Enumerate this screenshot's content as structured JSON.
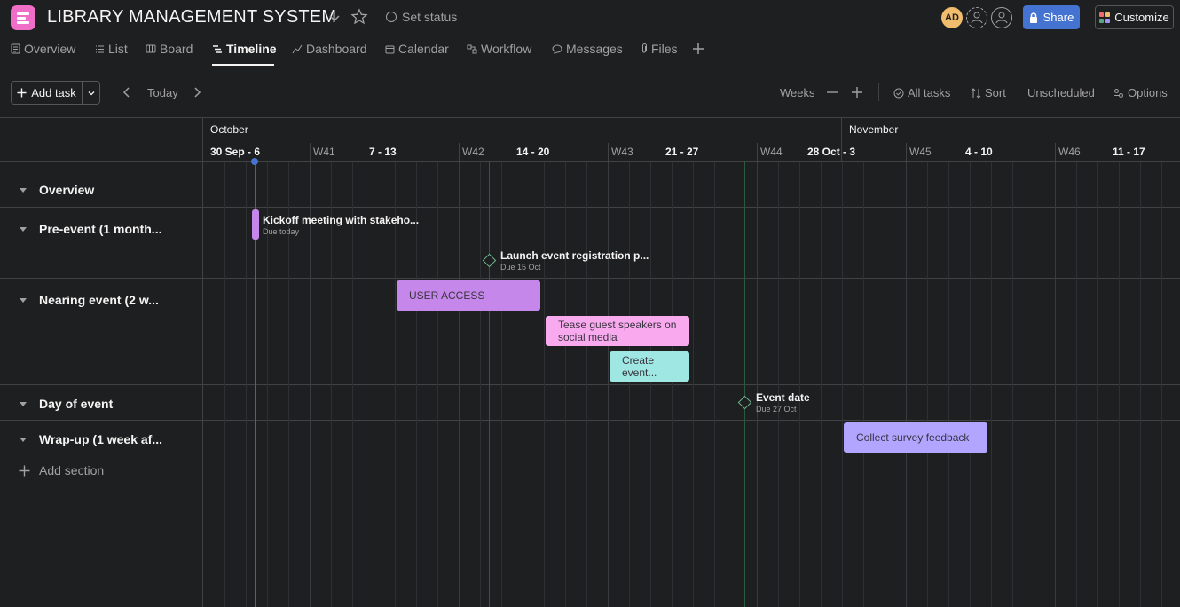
{
  "header": {
    "project_title": "LIBRARY MANAGEMENT SYSTEM",
    "set_status_label": "Set status",
    "avatar_initials": "AD",
    "share_label": "Share",
    "customize_label": "Customize"
  },
  "tabs": [
    {
      "label": "Overview",
      "icon": "overview-icon"
    },
    {
      "label": "List",
      "icon": "list-icon"
    },
    {
      "label": "Board",
      "icon": "board-icon"
    },
    {
      "label": "Timeline",
      "icon": "timeline-icon",
      "active": true
    },
    {
      "label": "Dashboard",
      "icon": "dashboard-icon"
    },
    {
      "label": "Calendar",
      "icon": "calendar-icon"
    },
    {
      "label": "Workflow",
      "icon": "workflow-icon"
    },
    {
      "label": "Messages",
      "icon": "messages-icon"
    },
    {
      "label": "Files",
      "icon": "paperclip-icon"
    }
  ],
  "toolbar": {
    "add_task_label": "Add task",
    "today_label": "Today",
    "zoom_label": "Weeks",
    "all_tasks_label": "All tasks",
    "sort_label": "Sort",
    "unscheduled_label": "Unscheduled",
    "options_label": "Options"
  },
  "timeline": {
    "months": [
      "October",
      "November"
    ],
    "weeks": [
      {
        "week": "",
        "range": "30 Sep - 6"
      },
      {
        "week": "W41",
        "range": "7 - 13"
      },
      {
        "week": "W42",
        "range": "14 - 20"
      },
      {
        "week": "W43",
        "range": "21 - 27"
      },
      {
        "week": "W44",
        "range": "28 Oct - 3"
      },
      {
        "week": "W45",
        "range": "4 - 10"
      },
      {
        "week": "W46",
        "range": "11 - 17"
      }
    ],
    "sections": [
      {
        "label": "Overview"
      },
      {
        "label": "Pre-event (1 month..."
      },
      {
        "label": "Nearing event (2 w..."
      },
      {
        "label": "Day of event"
      },
      {
        "label": "Wrap-up (1 week af..."
      }
    ],
    "add_section_label": "Add section",
    "tasks": {
      "kickoff": {
        "title": "Kickoff meeting with stakeho...",
        "due": "Due today"
      },
      "launch": {
        "title": "Launch event registration p...",
        "due": "Due 15 Oct"
      },
      "user_access": {
        "title": "USER ACCESS"
      },
      "tease": {
        "title": "Tease guest speakers on social media"
      },
      "create": {
        "title": "Create event..."
      },
      "event_date": {
        "title": "Event date",
        "due": "Due 27 Oct"
      },
      "survey": {
        "title": "Collect survey feedback"
      }
    }
  },
  "colors": {
    "background": "#1e1f21",
    "accent": "#4573d2",
    "user_access": "#c587ea",
    "tease": "#f9aaef",
    "create": "#9ee7e3",
    "survey": "#b1a5ff",
    "milestone": "#6fb58b"
  }
}
